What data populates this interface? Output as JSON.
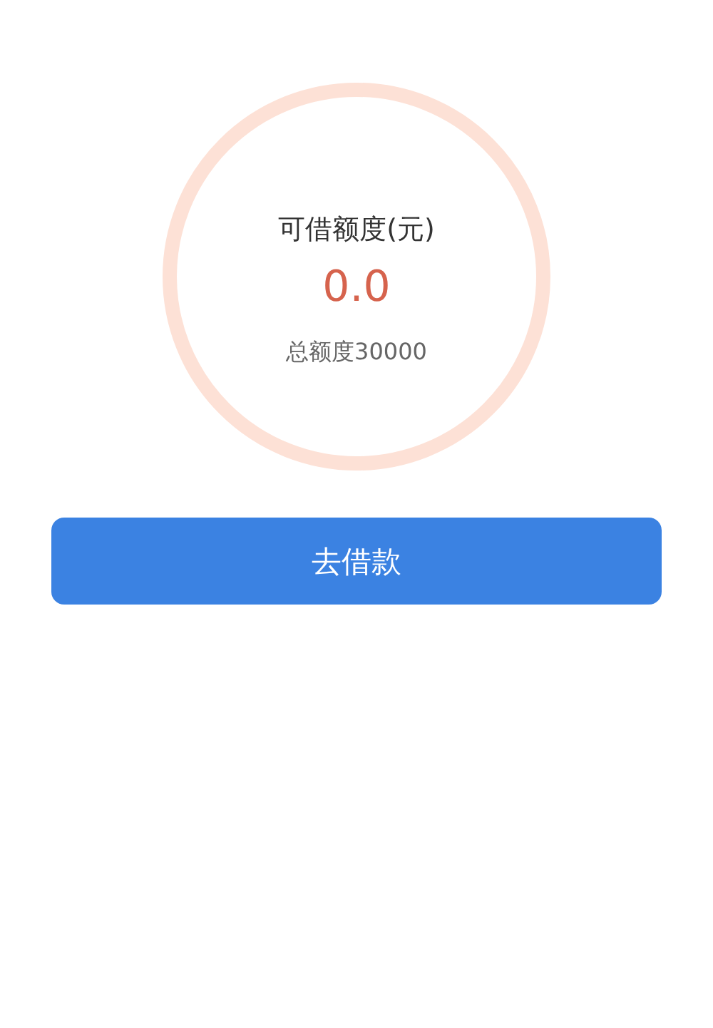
{
  "quota": {
    "title": "可借额度(元)",
    "amount": "0.0",
    "total": "总额度30000"
  },
  "button": {
    "label": "去借款"
  }
}
